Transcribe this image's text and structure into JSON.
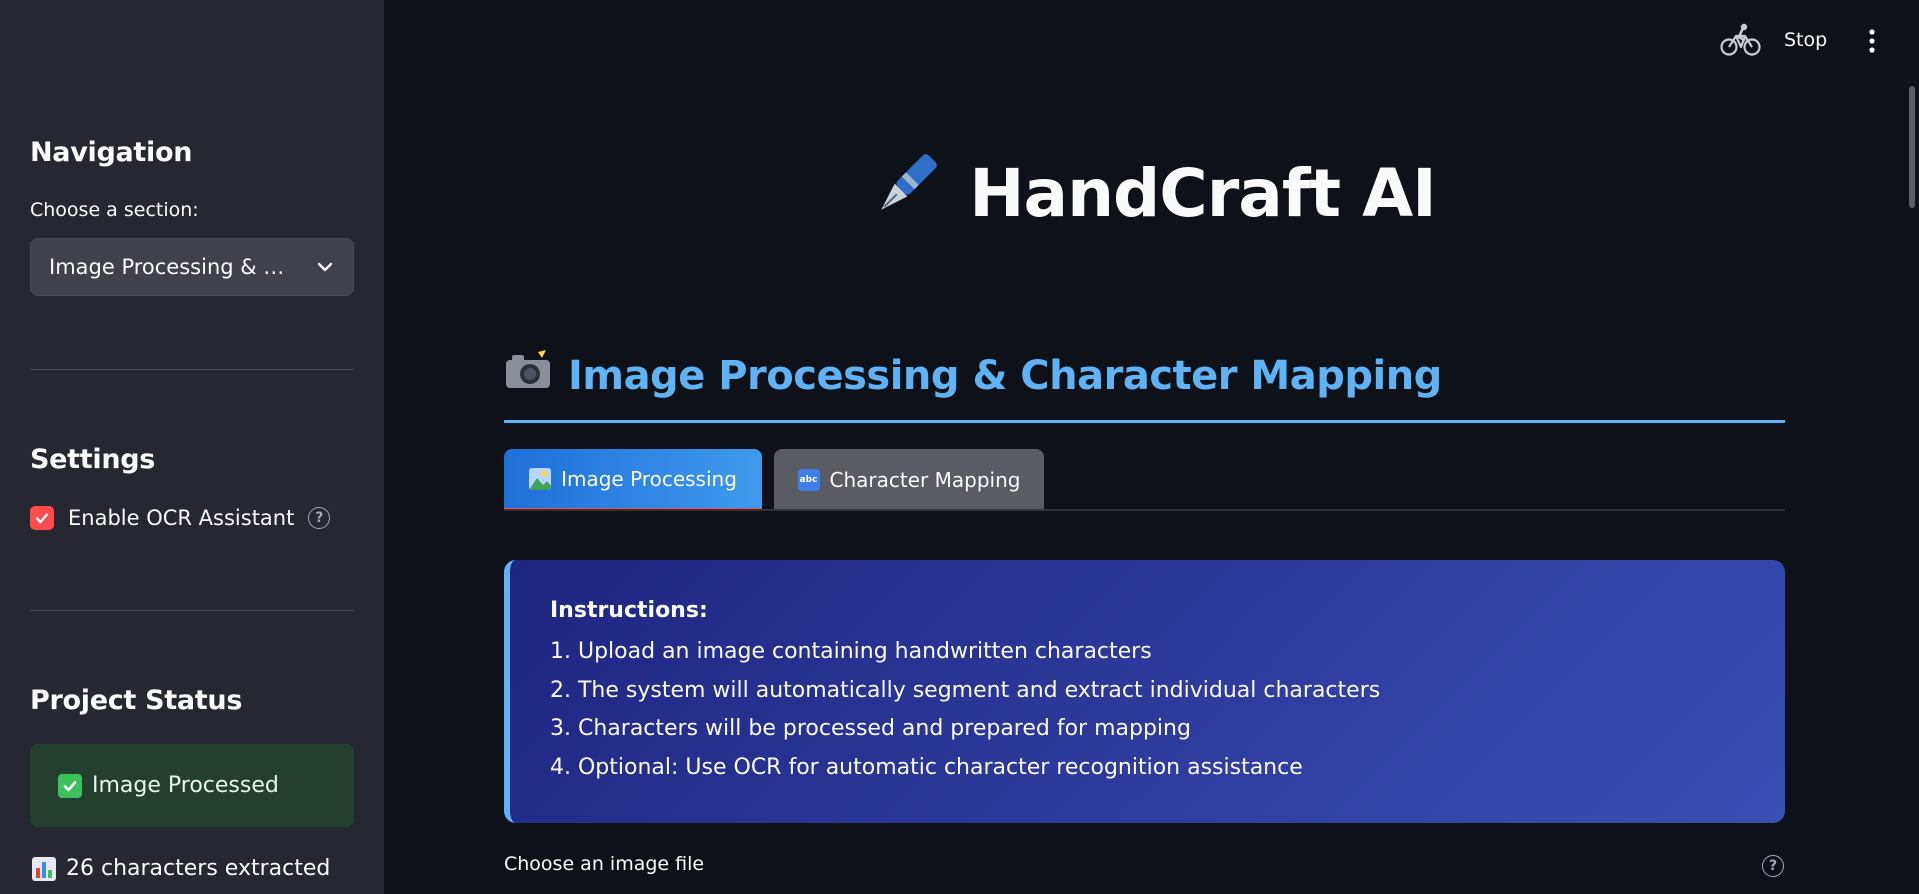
{
  "sidebar": {
    "navigation_heading": "Navigation",
    "select_label": "Choose a section:",
    "select_value": "Image Processing & …",
    "settings_heading": "Settings",
    "ocr_checkbox_label": "Enable OCR Assistant",
    "ocr_checked": true,
    "status_heading": "Project Status",
    "status_message": "Image Processed",
    "characters_stat": "26 characters extracted"
  },
  "topbar": {
    "stop_label": "Stop",
    "running_icon": "bicycle-icon",
    "menu_icon": "kebab-menu-icon"
  },
  "main": {
    "app_title": "HandCraft AI",
    "app_title_icon": "fountain-pen-icon",
    "section_title": "Image Processing & Character Mapping",
    "section_icon": "camera-flash-icon",
    "tabs": [
      {
        "label": "Image Processing",
        "icon": "framed-picture-icon",
        "active": true
      },
      {
        "label": "Character Mapping",
        "icon": "abc-icon",
        "active": false
      }
    ],
    "instructions": {
      "title": "Instructions:",
      "lines": [
        "1. Upload an image containing handwritten characters",
        "2. The system will automatically segment and extract individual characters",
        "3. Characters will be processed and prepared for mapping",
        "4. Optional: Use OCR for automatic character recognition assistance"
      ]
    },
    "uploader_label": "Choose an image file"
  },
  "colors": {
    "background": "#0e1117",
    "sidebar": "#262730",
    "accent_blue": "#5fb3f5",
    "primary_red": "#ff4b4b",
    "success_bg": "#22402d"
  }
}
